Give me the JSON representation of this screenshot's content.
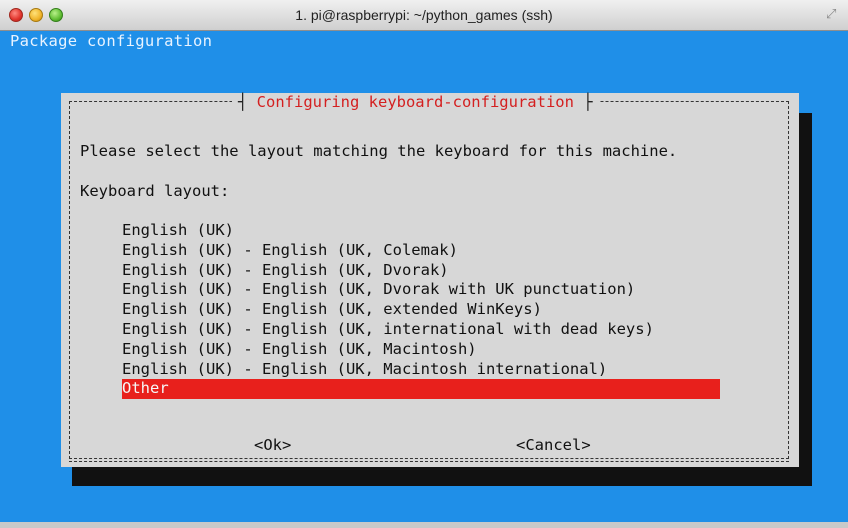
{
  "window": {
    "title": "1. pi@raspberrypi: ~/python_games (ssh)"
  },
  "terminal": {
    "header": "Package configuration"
  },
  "dialog": {
    "title": "Configuring keyboard-configuration",
    "prompt": "Please select the layout matching the keyboard for this machine.",
    "field_label": "Keyboard layout:",
    "options": [
      "English (UK)",
      "English (UK) - English (UK, Colemak)",
      "English (UK) - English (UK, Dvorak)",
      "English (UK) - English (UK, Dvorak with UK punctuation)",
      "English (UK) - English (UK, extended WinKeys)",
      "English (UK) - English (UK, international with dead keys)",
      "English (UK) - English (UK, Macintosh)",
      "English (UK) - English (UK, Macintosh international)",
      "Other"
    ],
    "selected_option": "Other",
    "ok_label": "<Ok>",
    "cancel_label": "<Cancel>"
  },
  "colors": {
    "terminal_background": "#1f8fe8",
    "dialog_background": "#d7d7d7",
    "dialog_title": "#d42020",
    "selection": "#e8201c"
  }
}
